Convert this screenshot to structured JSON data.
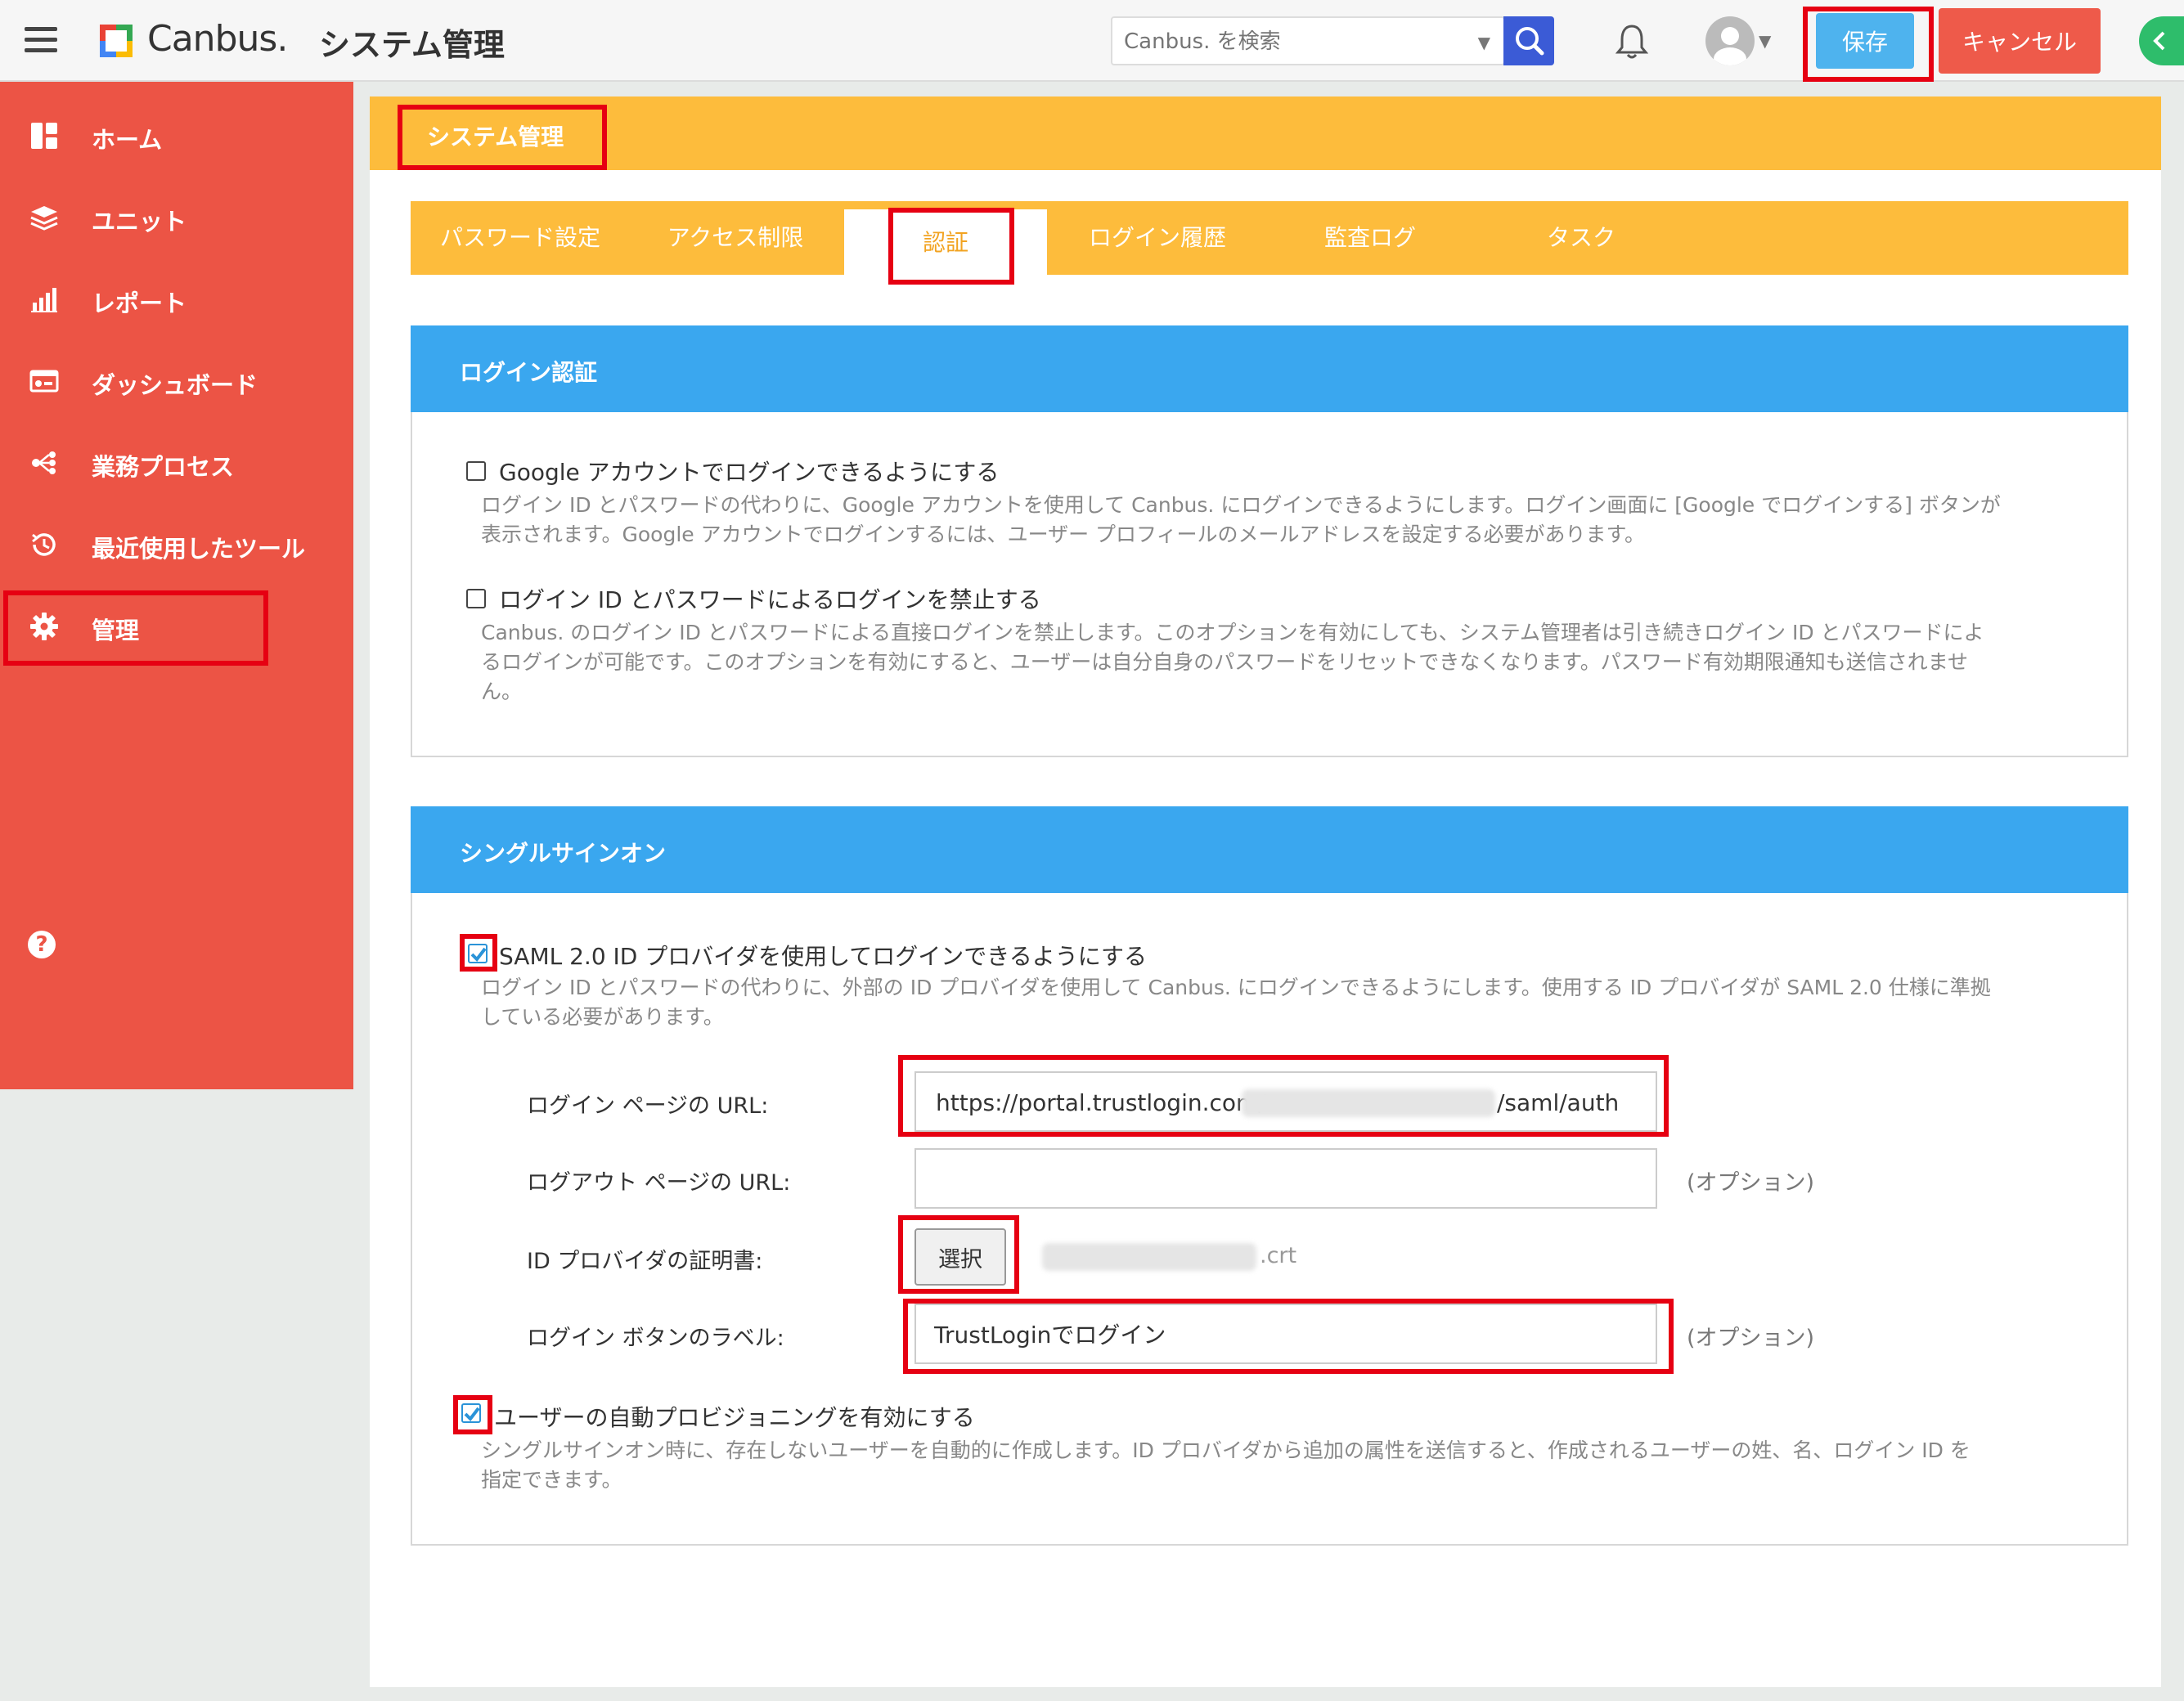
{
  "header": {
    "logo_text": "Canbus.",
    "app_title": "システム管理",
    "search_placeholder": "Canbus. を検索",
    "save_label": "保存",
    "cancel_label": "キャンセル"
  },
  "sidebar": {
    "items": [
      {
        "label": "ホーム",
        "icon": "dashboard-grid-icon"
      },
      {
        "label": "ユニット",
        "icon": "layers-icon"
      },
      {
        "label": "レポート",
        "icon": "bar-chart-icon"
      },
      {
        "label": "ダッシュボード",
        "icon": "monitor-icon"
      },
      {
        "label": "業務プロセス",
        "icon": "process-flow-icon"
      },
      {
        "label": "最近使用したツール",
        "icon": "history-icon"
      },
      {
        "label": "管理",
        "icon": "gear-icon"
      }
    ],
    "help_glyph": "?"
  },
  "section": {
    "title": "システム管理"
  },
  "tabs": [
    {
      "label": "パスワード設定"
    },
    {
      "label": "アクセス制限"
    },
    {
      "label": "認証",
      "active": true
    },
    {
      "label": "ログイン履歴"
    },
    {
      "label": "監査ログ"
    },
    {
      "label": "タスク"
    }
  ],
  "login_auth": {
    "title": "ログイン認証",
    "options": [
      {
        "label": "Google アカウントでログインできるようにする",
        "checked": false,
        "desc_lines": [
          "ログイン ID とパスワードの代わりに、Google アカウントを使用して Canbus. にログインできるようにします。ログイン画面に [Google でログインする] ボタンが",
          "表示されます。Google アカウントでログインするには、ユーザー プロフィールのメールアドレスを設定する必要があります。"
        ]
      },
      {
        "label": "ログイン ID とパスワードによるログインを禁止する",
        "checked": false,
        "desc_lines": [
          "Canbus. のログイン ID とパスワードによる直接ログインを禁止します。このオプションを有効にしても、システム管理者は引き続きログイン ID とパスワードによ",
          "るログインが可能です。このオプションを有効にすると、ユーザーは自分自身のパスワードをリセットできなくなります。パスワード有効期限通知も送信されませ",
          "ん。"
        ]
      }
    ]
  },
  "sso": {
    "title": "シングルサインオン",
    "saml": {
      "label": "SAML 2.0 ID プロバイダを使用してログインできるようにする",
      "checked": true,
      "desc_lines": [
        "ログイン ID とパスワードの代わりに、外部の ID プロバイダを使用して Canbus. にログインできるようにします。使用する ID プロバイダが SAML 2.0 仕様に準拠",
        "している必要があります。"
      ]
    },
    "login_url": {
      "label": "ログイン ページの URL:",
      "prefix": "https://portal.trustlogin.com/",
      "suffix": "/saml/auth"
    },
    "logout_url": {
      "label": "ログアウト ページの URL:",
      "value": "",
      "hint": "(オプション)"
    },
    "certificate": {
      "label": "ID プロバイダの証明書:",
      "button": "選択",
      "file_suffix": ".crt"
    },
    "button_label": {
      "label": "ログイン ボタンのラベル:",
      "value": "TrustLoginでログイン",
      "hint": "(オプション)"
    },
    "provisioning": {
      "label": "ユーザーの自動プロビジョニングを有効にする",
      "checked": true,
      "desc_lines": [
        "シングルサインオン時に、存在しないユーザーを自動的に作成します。ID プロバイダから追加の属性を送信すると、作成されるユーザーの姓、名、ログイン ID を",
        "指定できます。"
      ]
    }
  },
  "colors": {
    "sidebar": "#ec5445",
    "banner": "#fdbc3c",
    "panel_header": "#3aa7ef",
    "save": "#4eb3ee",
    "cancel": "#ee5a4a",
    "highlight": "#e60012"
  }
}
